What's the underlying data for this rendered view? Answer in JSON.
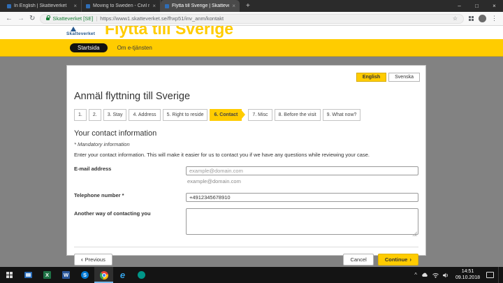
{
  "theme": {
    "brand_yellow": "#ffcc00",
    "secure_green": "#188038",
    "page_background_gray": "#828282",
    "logo_blue": "#27598f",
    "taskbar_active_underline": "#76b9ed"
  },
  "icons": {
    "back": "←",
    "forward": "→",
    "reload": "↻",
    "star": "☆",
    "menu": "⋮",
    "close_tab": "×",
    "new_tab": "+",
    "chevron_left": "‹",
    "chevron_right": "›",
    "tray_expand": "^",
    "minimize": "–",
    "maximize": "□",
    "close": "×"
  },
  "browser": {
    "tabs": [
      {
        "title": "In English | Skatteverket"
      },
      {
        "title": "Moving to Sweden - Civil regist…"
      },
      {
        "title": "Flytta till Sverige | Skatteverket"
      }
    ],
    "address": {
      "secure_label": "Skatteverket [SE]",
      "separator": "|",
      "url": "https://www1.skatteverket.se/fhxp51/inv_anm/kontakt"
    }
  },
  "site": {
    "logo_text": "Skatteverket",
    "header_title": "Flytta till Sverige",
    "nav": {
      "home": "Startsida",
      "about": "Om e-tjänsten"
    }
  },
  "form_page": {
    "languages": [
      {
        "label": "English"
      },
      {
        "label": "Svenska"
      }
    ],
    "title": "Anmäl flyttning till Sverige",
    "steps": [
      {
        "label": "1."
      },
      {
        "label": "2."
      },
      {
        "label": "3. Stay"
      },
      {
        "label": "4. Address"
      },
      {
        "label": "5. Right to reside"
      },
      {
        "label": "6. Contact"
      },
      {
        "label": "7. Misc"
      },
      {
        "label": "8. Before the visit"
      },
      {
        "label": "9. What now?"
      }
    ],
    "section_title": "Your contact information",
    "mandatory_note": "* Mandatory information",
    "intro": "Enter your contact information. This will make it easier for us to contact you if we have any questions while reviewing your case.",
    "fields": {
      "email": {
        "label": "E-mail address",
        "placeholder": "example@domain.com",
        "helper": "example@domain.com",
        "value": ""
      },
      "phone": {
        "label": "Telephone number *",
        "value": "+4912345678910"
      },
      "other": {
        "label": "Another way of contacting you",
        "value": ""
      }
    },
    "buttons": {
      "previous": "Previous",
      "cancel": "Cancel",
      "continue": "Continue"
    }
  },
  "taskbar": {
    "apps": [
      {
        "name": "mail"
      },
      {
        "name": "excel",
        "letter": "X",
        "color": "#1e7145"
      },
      {
        "name": "word",
        "letter": "W",
        "color": "#2b579a"
      },
      {
        "name": "skype",
        "letter": "S",
        "color": "#0078d4"
      },
      {
        "name": "chrome",
        "active": true
      },
      {
        "name": "edge",
        "letter": "e"
      },
      {
        "name": "teams",
        "letter": "",
        "color": "#009688"
      }
    ],
    "clock": {
      "time": "14:51",
      "date": "09.10.2018"
    }
  }
}
